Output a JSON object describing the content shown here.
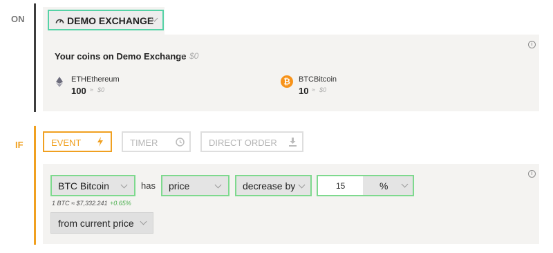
{
  "on_section": {
    "label": "ON",
    "exchange_button": {
      "label": "DEMO EXCHANGE",
      "icon": "gauge-icon"
    },
    "coins_panel": {
      "title": "Your coins on Demo Exchange",
      "title_approx": "≈",
      "title_value": "$0",
      "coins": [
        {
          "symbol": "ETH",
          "name": "Ethereum",
          "amount": "100",
          "approx": "≈",
          "value": "$0",
          "icon": "ethereum-icon"
        },
        {
          "symbol": "BTC",
          "name": "Bitcoin",
          "amount": "10",
          "approx": "≈",
          "value": "$0",
          "icon": "bitcoin-icon",
          "icon_color": "#f7931a"
        }
      ]
    }
  },
  "if_section": {
    "label": "IF",
    "tabs": [
      {
        "label": "EVENT",
        "active": true,
        "icon": "lightning-icon"
      },
      {
        "label": "TIMER",
        "active": false,
        "icon": "clock-icon"
      },
      {
        "label": "DIRECT ORDER",
        "active": false,
        "icon": "download-icon"
      }
    ],
    "condition": {
      "coin_select": "BTC Bitcoin",
      "has_label": "has",
      "metric_select": "price",
      "direction_select": "decrease by",
      "amount_value": "15",
      "unit_select": "%",
      "rate_text": "1 BTC ≈ $7,332.241",
      "rate_change": "+0.65%",
      "reference_select": "from current price"
    }
  },
  "colors": {
    "accent_orange": "#f0a020",
    "on_bar": "#3d3d3d",
    "select_border": "#7ed98e",
    "exchange_border": "#55d2a6",
    "positive": "#4cb050"
  }
}
